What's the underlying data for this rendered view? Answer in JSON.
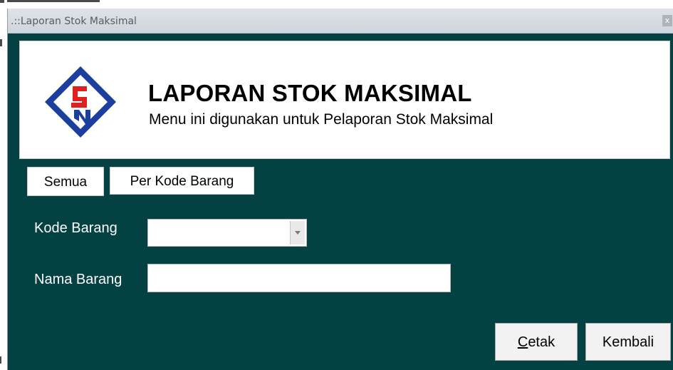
{
  "window": {
    "title": ".::Laporan Stok Maksimal",
    "close_glyph": "x"
  },
  "header": {
    "title": "LAPORAN STOK MAKSIMAL",
    "subtitle": "Menu ini digunakan untuk Pelaporan Stok Maksimal",
    "logo_icon": "company-logo",
    "colors": {
      "logo_blue": "#1b3f9e",
      "logo_red": "#e02020"
    }
  },
  "tabs": [
    {
      "label": "Semua"
    },
    {
      "label": "Per Kode Barang"
    }
  ],
  "form": {
    "kode_label": "Kode Barang",
    "kode_value": "",
    "nama_label": "Nama Barang",
    "nama_value": ""
  },
  "buttons": {
    "cetak": {
      "accel": "C",
      "rest": "etak"
    },
    "kembali": "Kembali"
  },
  "colors": {
    "background": "#034143",
    "titlebar": "#d6dbe0"
  }
}
